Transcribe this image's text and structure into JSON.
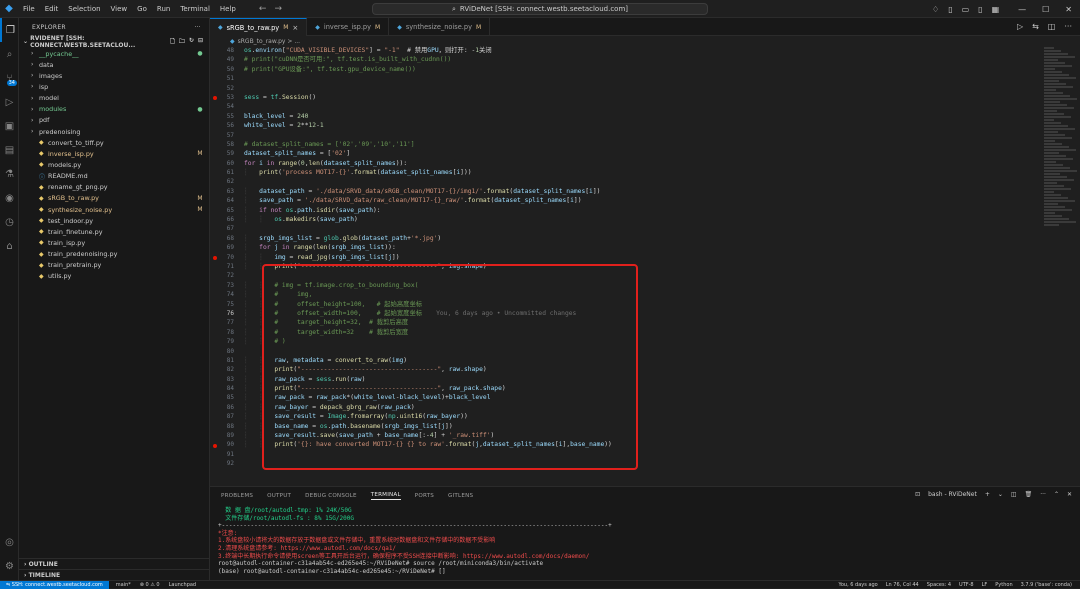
{
  "menu": [
    "File",
    "Edit",
    "Selection",
    "View",
    "Go",
    "Run",
    "Terminal",
    "Help"
  ],
  "search_text": "RViDeNet [SSH: connect.westb.seetacloud.com]",
  "sidebar": {
    "title": "EXPLORER",
    "root": "RVIDENET [SSH: CONNECT.WESTB.SEETACLOU...",
    "items": [
      {
        "name": "__pycache__",
        "type": "folder",
        "color": "green",
        "status": "●"
      },
      {
        "name": "data",
        "type": "folder",
        "color": "folder",
        "status": ""
      },
      {
        "name": "images",
        "type": "folder",
        "color": "folder",
        "status": ""
      },
      {
        "name": "isp",
        "type": "folder",
        "color": "folder",
        "status": ""
      },
      {
        "name": "model",
        "type": "folder",
        "color": "folder",
        "status": ""
      },
      {
        "name": "modules",
        "type": "folder",
        "color": "green",
        "status": "●"
      },
      {
        "name": "pdf",
        "type": "folder",
        "color": "folder",
        "status": ""
      },
      {
        "name": "predenoising",
        "type": "folder",
        "color": "folder",
        "status": ""
      },
      {
        "name": "convert_to_tiff.py",
        "type": "file",
        "color": "folder",
        "status": ""
      },
      {
        "name": "inverse_isp.py",
        "type": "file",
        "color": "mod",
        "status": "M"
      },
      {
        "name": "models.py",
        "type": "file",
        "color": "folder",
        "status": ""
      },
      {
        "name": "README.md",
        "type": "md",
        "color": "folder",
        "status": ""
      },
      {
        "name": "rename_gt_png.py",
        "type": "file",
        "color": "folder",
        "status": ""
      },
      {
        "name": "sRGB_to_raw.py",
        "type": "file",
        "color": "mod",
        "status": "M"
      },
      {
        "name": "synthesize_noise.py",
        "type": "file",
        "color": "mod",
        "status": "M"
      },
      {
        "name": "test_indoor.py",
        "type": "file",
        "color": "folder",
        "status": ""
      },
      {
        "name": "train_finetune.py",
        "type": "file",
        "color": "folder",
        "status": ""
      },
      {
        "name": "train_isp.py",
        "type": "file",
        "color": "folder",
        "status": ""
      },
      {
        "name": "train_predenoising.py",
        "type": "file",
        "color": "folder",
        "status": ""
      },
      {
        "name": "train_pretrain.py",
        "type": "file",
        "color": "folder",
        "status": ""
      },
      {
        "name": "utils.py",
        "type": "file",
        "color": "folder",
        "status": ""
      }
    ],
    "outline": "OUTLINE",
    "timeline": "TIMELINE"
  },
  "activity_badge": "34",
  "tabs": [
    {
      "label": "sRGB_to_raw.py",
      "mod": "M",
      "active": true
    },
    {
      "label": "inverse_isp.py",
      "mod": "M",
      "active": false
    },
    {
      "label": "synthesize_noise.py",
      "mod": "M",
      "active": false
    }
  ],
  "breadcrumb": "sRGB_to_raw.py > ...",
  "editor": {
    "blame": "You, 6 days ago • Uncommitted changes",
    "current_line": 76,
    "breakpoints": [
      53,
      70,
      90
    ],
    "lines": [
      {
        "n": 48,
        "t": "os.environ[\"CUDA_VISIBLE_DEVICES\"] = \"-1\"  # 禁用GPU，则打开: -1关闭"
      },
      {
        "n": 49,
        "t": "# print(\"cuDNN是否可用:\", tf.test.is_built_with_cudnn())"
      },
      {
        "n": 50,
        "t": "# print(\"GPU设备:\", tf.test.gpu_device_name())"
      },
      {
        "n": 51,
        "t": ""
      },
      {
        "n": 52,
        "t": ""
      },
      {
        "n": 53,
        "t": "sess = tf.Session()"
      },
      {
        "n": 54,
        "t": ""
      },
      {
        "n": 55,
        "t": "black_level = 240"
      },
      {
        "n": 56,
        "t": "white_level = 2**12-1"
      },
      {
        "n": 57,
        "t": ""
      },
      {
        "n": 58,
        "t": "# dataset_split_names = ['02','09','10','11']"
      },
      {
        "n": 59,
        "t": "dataset_split_names = ['02']"
      },
      {
        "n": 60,
        "t": "for i in range(0,len(dataset_split_names)):"
      },
      {
        "n": 61,
        "t": "    print('process MOT17-{}'.format(dataset_split_names[i]))"
      },
      {
        "n": 62,
        "t": ""
      },
      {
        "n": 63,
        "t": "    dataset_path = './data/SRVD_data/sRGB_clean/MOT17-{}/img1/'.format(dataset_split_names[i])"
      },
      {
        "n": 64,
        "t": "    save_path = './data/SRVD_data/raw_clean/MOT17-{}_raw/'.format(dataset_split_names[i])"
      },
      {
        "n": 65,
        "t": "    if not os.path.isdir(save_path):"
      },
      {
        "n": 66,
        "t": "        os.makedirs(save_path)"
      },
      {
        "n": 67,
        "t": ""
      },
      {
        "n": 68,
        "t": "    srgb_imgs_list = glob.glob(dataset_path+'*.jpg')"
      },
      {
        "n": 69,
        "t": "    for j in range(len(srgb_imgs_list)):"
      },
      {
        "n": 70,
        "t": "        img = read_jpg(srgb_imgs_list[j])"
      },
      {
        "n": 71,
        "t": "        print(\"------------------------------------\", img.shape)"
      },
      {
        "n": 72,
        "t": ""
      },
      {
        "n": 73,
        "t": "        # img = tf.image.crop_to_bounding_box("
      },
      {
        "n": 74,
        "t": "        #     img,"
      },
      {
        "n": 75,
        "t": "        #     offset_height=100,   # 起始高度坐标"
      },
      {
        "n": 76,
        "t": "        #     offset_width=100,    # 起始宽度坐标"
      },
      {
        "n": 77,
        "t": "        #     target_height=32,  # 裁剪后高度"
      },
      {
        "n": 78,
        "t": "        #     target_width=32    # 裁剪后宽度"
      },
      {
        "n": 79,
        "t": "        # )"
      },
      {
        "n": 80,
        "t": ""
      },
      {
        "n": 81,
        "t": "        raw, metadata = convert_to_raw(img)"
      },
      {
        "n": 82,
        "t": "        print(\"------------------------------------\", raw.shape)"
      },
      {
        "n": 83,
        "t": "        raw_pack = sess.run(raw)"
      },
      {
        "n": 84,
        "t": "        print(\"------------------------------------\", raw_pack.shape)"
      },
      {
        "n": 85,
        "t": "        raw_pack = raw_pack*(white_level-black_level)+black_level"
      },
      {
        "n": 86,
        "t": "        raw_bayer = depack_gbrg_raw(raw_pack)"
      },
      {
        "n": 87,
        "t": "        save_result = Image.fromarray(np.uint16(raw_bayer))"
      },
      {
        "n": 88,
        "t": "        base_name = os.path.basename(srgb_imgs_list[j])"
      },
      {
        "n": 89,
        "t": "        save_result.save(save_path + base_name[:-4] + '_raw.tiff')"
      },
      {
        "n": 90,
        "t": "        print('{}: have converted MOT17-{} {} to raw'.format(j,dataset_split_names[i],base_name))"
      },
      {
        "n": 91,
        "t": ""
      },
      {
        "n": 92,
        "t": ""
      }
    ]
  },
  "panel": {
    "tabs": [
      "PROBLEMS",
      "OUTPUT",
      "DEBUG CONSOLE",
      "TERMINAL",
      "PORTS",
      "GITLENS"
    ],
    "active_tab": "TERMINAL",
    "terminal_name": "bash - RViDeNet",
    "terminal_lines": [
      {
        "cls": "t-green",
        "t": "  数 据 盘/root/autodl-tmp: 1% 24K/50G"
      },
      {
        "cls": "t-green",
        "t": "  文件存储/root/autodl-fs : 8% 15G/200G"
      },
      {
        "cls": "t-white",
        "t": "+-----------------------------------------------------------------------------------------------------------+"
      },
      {
        "cls": "t-red",
        "t": "*注意: "
      },
      {
        "cls": "t-red",
        "t": "1.系统盘较小请将大的数据存放于数据盘或文件存储中，重置系统时数据盘和文件存储中的数据不受影响"
      },
      {
        "cls": "t-red",
        "t": "2.清理系统盘请参考: https://www.autodl.com/docs/qa1/"
      },
      {
        "cls": "t-red",
        "t": "3.终端中长期执行命令请使用screen等工具开后台运行，确保程序不受SSH连接中断影响: https://www.autodl.com/docs/daemon/"
      },
      {
        "cls": "t-white",
        "t": "root@autodl-container-c31a4ab54c-ed265e45:~/RViDeNet# source /root/miniconda3/bin/activate"
      },
      {
        "cls": "t-white",
        "t": "(base) root@autodl-container-c31a4ab54c-ed265e45:~/RViDeNet# []"
      }
    ]
  },
  "status": {
    "remote": "SSH: connect.westb.seetacloud.com",
    "items": [
      "main*",
      "⊗ 0 ⚠ 0",
      "Launchpad"
    ],
    "right": [
      "You, 6 days ago",
      "Ln 76, Col 44",
      "Spaces: 4",
      "UTF-8",
      "LF",
      "Python",
      "3.7.9 ('base': conda)"
    ]
  }
}
